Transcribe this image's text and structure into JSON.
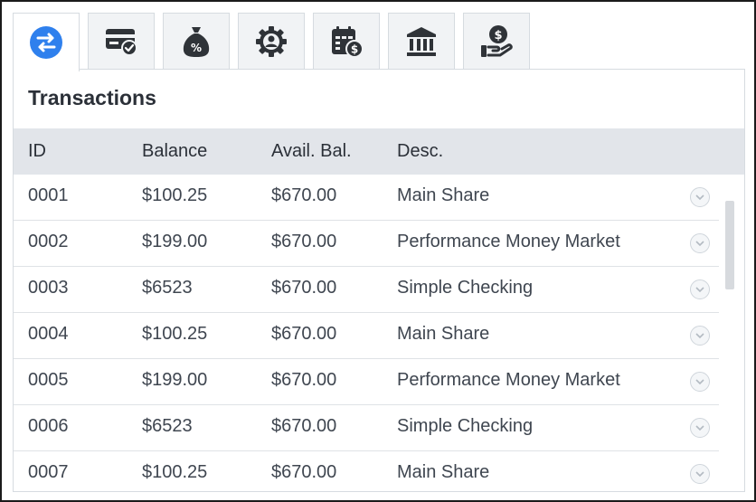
{
  "tabs": [
    {
      "name": "transfer",
      "icon": "transfer-arrows-icon",
      "active": true
    },
    {
      "name": "card-approved",
      "icon": "credit-card-check-icon",
      "active": false
    },
    {
      "name": "loan-rate",
      "icon": "money-bag-percent-icon",
      "active": false
    },
    {
      "name": "account-settings",
      "icon": "gear-user-icon",
      "active": false
    },
    {
      "name": "bill-calendar",
      "icon": "calendar-dollar-icon",
      "active": false
    },
    {
      "name": "bank",
      "icon": "bank-building-icon",
      "active": false
    },
    {
      "name": "deposit",
      "icon": "hand-dollar-coin-icon",
      "active": false
    }
  ],
  "panel": {
    "title": "Transactions"
  },
  "table": {
    "columns": {
      "id": "ID",
      "balance": "Balance",
      "available": "Avail. Bal.",
      "desc": "Desc."
    },
    "rows": [
      {
        "id": "0001",
        "balance": "$100.25",
        "available": "$670.00",
        "desc": "Main Share"
      },
      {
        "id": "0002",
        "balance": "$199.00",
        "available": "$670.00",
        "desc": "Performance Money Market"
      },
      {
        "id": "0003",
        "balance": "$6523",
        "available": "$670.00",
        "desc": "Simple Checking"
      },
      {
        "id": "0004",
        "balance": "$100.25",
        "available": "$670.00",
        "desc": "Main Share"
      },
      {
        "id": "0005",
        "balance": "$199.00",
        "available": "$670.00",
        "desc": "Performance Money Market"
      },
      {
        "id": "0006",
        "balance": "$6523",
        "available": "$670.00",
        "desc": "Simple Checking"
      },
      {
        "id": "0007",
        "balance": "$100.25",
        "available": "$670.00",
        "desc": "Main Share"
      }
    ]
  },
  "colors": {
    "accent": "#2f80ed",
    "icon": "#2f3338",
    "header_bg": "#e2e5ea"
  }
}
